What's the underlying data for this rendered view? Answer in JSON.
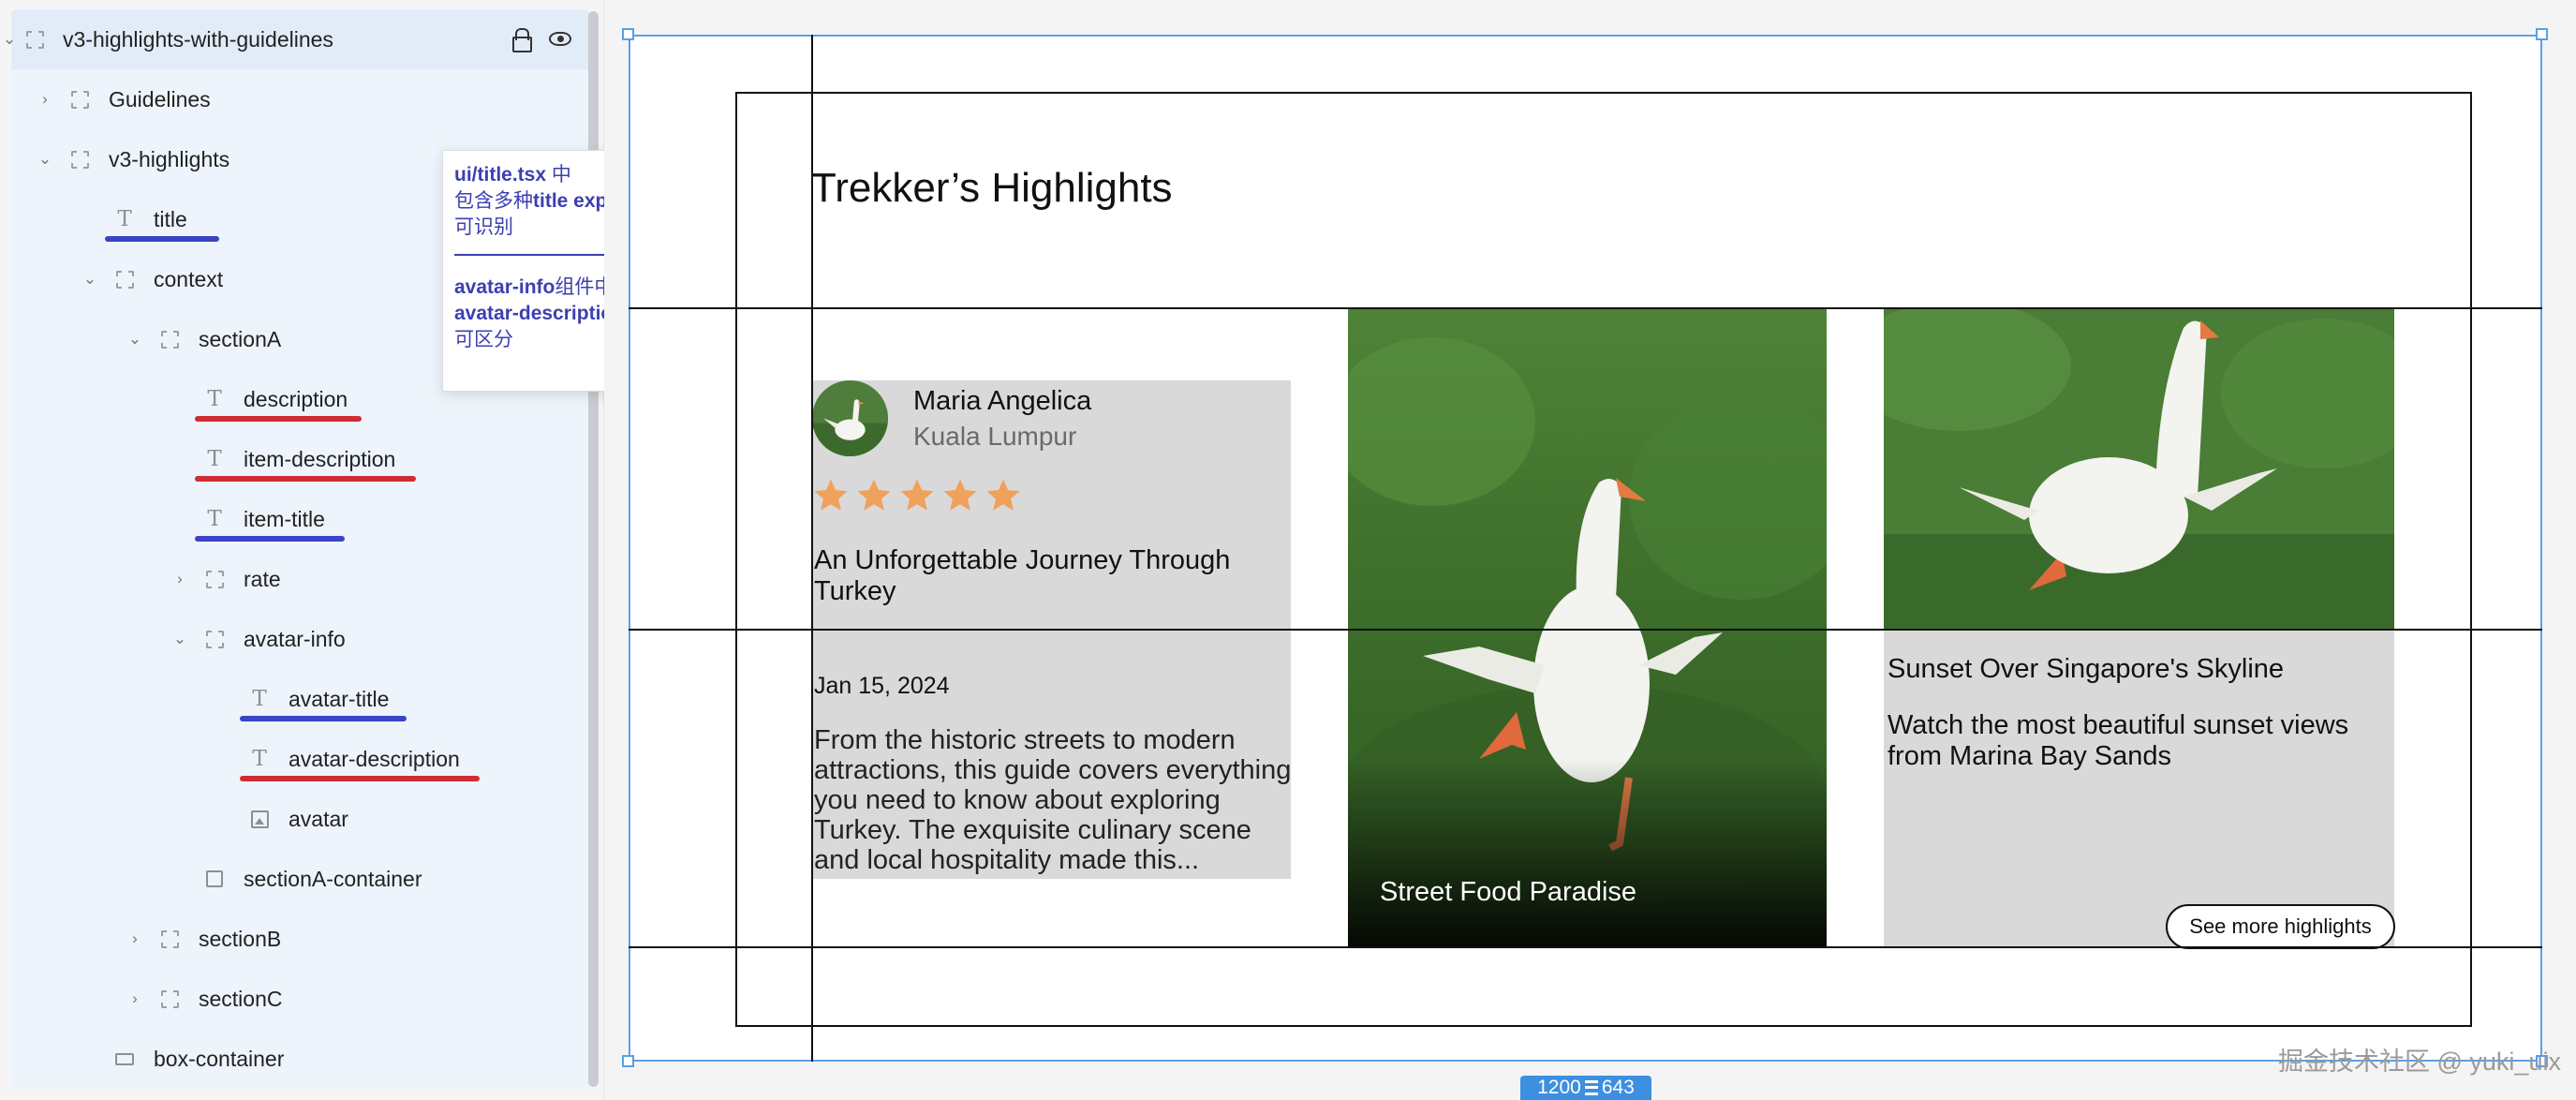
{
  "layers": {
    "root": "v3-highlights-with-guidelines",
    "items": [
      {
        "label": "Guidelines",
        "type": "frame",
        "expandable": "collapsed"
      },
      {
        "label": "v3-highlights",
        "type": "frame",
        "expandable": "expanded"
      },
      {
        "label": "title",
        "type": "text",
        "marker": "blue"
      },
      {
        "label": "context",
        "type": "frame",
        "expandable": "expanded"
      },
      {
        "label": "sectionA",
        "type": "frame",
        "expandable": "expanded"
      },
      {
        "label": "description",
        "type": "text",
        "marker": "red"
      },
      {
        "label": "item-description",
        "type": "text",
        "marker": "red"
      },
      {
        "label": "item-title",
        "type": "text",
        "marker": "blue"
      },
      {
        "label": "rate",
        "type": "frame",
        "expandable": "collapsed"
      },
      {
        "label": "avatar-info",
        "type": "frame",
        "expandable": "expanded"
      },
      {
        "label": "avatar-title",
        "type": "text",
        "marker": "blue"
      },
      {
        "label": "avatar-description",
        "type": "text",
        "marker": "red"
      },
      {
        "label": "avatar",
        "type": "image"
      },
      {
        "label": "sectionA-container",
        "type": "rect"
      },
      {
        "label": "sectionB",
        "type": "frame",
        "expandable": "collapsed"
      },
      {
        "label": "sectionC",
        "type": "frame",
        "expandable": "collapsed"
      },
      {
        "label": "box-container",
        "type": "box"
      }
    ]
  },
  "note": {
    "line1_bold": "ui/title.tsx",
    "line1_rest": " 中",
    "line2_pre": "包含多种",
    "line2_bold": "title export,",
    "line3": "可识别",
    "line4_bold": "avatar-info",
    "line4_rest": "组件中包含",
    "line5_bold": "avatar-description,",
    "line6": "可区分"
  },
  "canvas": {
    "title": "Trekker’s Highlights",
    "sectionA": {
      "avatar_title": "Maria Angelica",
      "avatar_description": "Kuala Lumpur",
      "rating": 5,
      "rating_max": 5,
      "item_title": "An Unforgettable Journey Through Turkey",
      "date": "Jan 15, 2024",
      "description": "From the historic streets to modern attractions, this guide covers everything you need to know about exploring Turkey. The exquisite culinary scene and local hospitality made this..."
    },
    "sectionB": {
      "caption": "Street Food Paradise"
    },
    "sectionC": {
      "title": "Sunset Over Singapore's Skyline",
      "description": "Watch the most beautiful sunset views from Marina Bay Sands",
      "button": "See more highlights"
    },
    "size_badge": {
      "width": "1200",
      "height": "643"
    }
  },
  "watermark": "掘金技术社区 @ yuki_uix",
  "colors": {
    "accent": "#5aa0e6",
    "star": "#f0a15a",
    "marker_blue": "#3b44c4",
    "marker_red": "#cf2c34"
  }
}
